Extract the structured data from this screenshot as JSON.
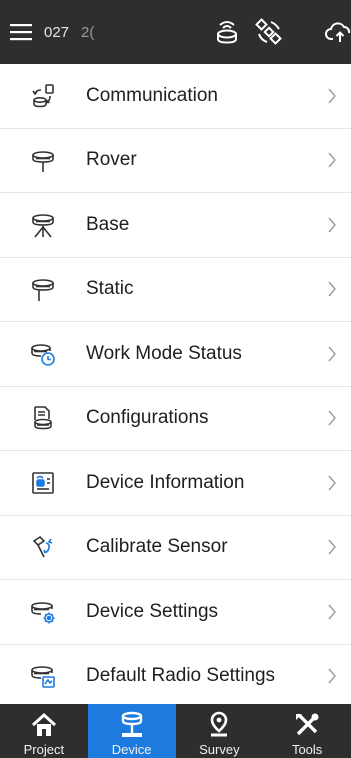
{
  "header": {
    "status_left": "027",
    "status_right": "2(",
    "icons": [
      "hamburger-menu-icon",
      "gnss-receiver-icon",
      "satellite-icon",
      "cloud-upload-icon"
    ]
  },
  "menu": {
    "items": [
      {
        "label": "Communication",
        "icon": "communication-icon"
      },
      {
        "label": "Rover",
        "icon": "rover-icon"
      },
      {
        "label": "Base",
        "icon": "base-tripod-icon"
      },
      {
        "label": "Static",
        "icon": "static-icon"
      },
      {
        "label": "Work Mode Status",
        "icon": "work-mode-status-icon"
      },
      {
        "label": "Configurations",
        "icon": "configurations-icon"
      },
      {
        "label": "Device Information",
        "icon": "device-information-icon"
      },
      {
        "label": "Calibrate Sensor",
        "icon": "calibrate-sensor-icon"
      },
      {
        "label": "Device Settings",
        "icon": "device-settings-icon"
      },
      {
        "label": "Default Radio Settings",
        "icon": "radio-settings-icon"
      }
    ]
  },
  "tabs": [
    {
      "label": "Project",
      "icon": "home-icon",
      "active": false
    },
    {
      "label": "Device",
      "icon": "device-icon",
      "active": true
    },
    {
      "label": "Survey",
      "icon": "survey-pin-icon",
      "active": false
    },
    {
      "label": "Tools",
      "icon": "tools-icon",
      "active": false
    }
  ],
  "colors": {
    "bar_background": "#2e2e2e",
    "active_tab": "#1d7be0",
    "accent_blue": "#1d7be0"
  }
}
